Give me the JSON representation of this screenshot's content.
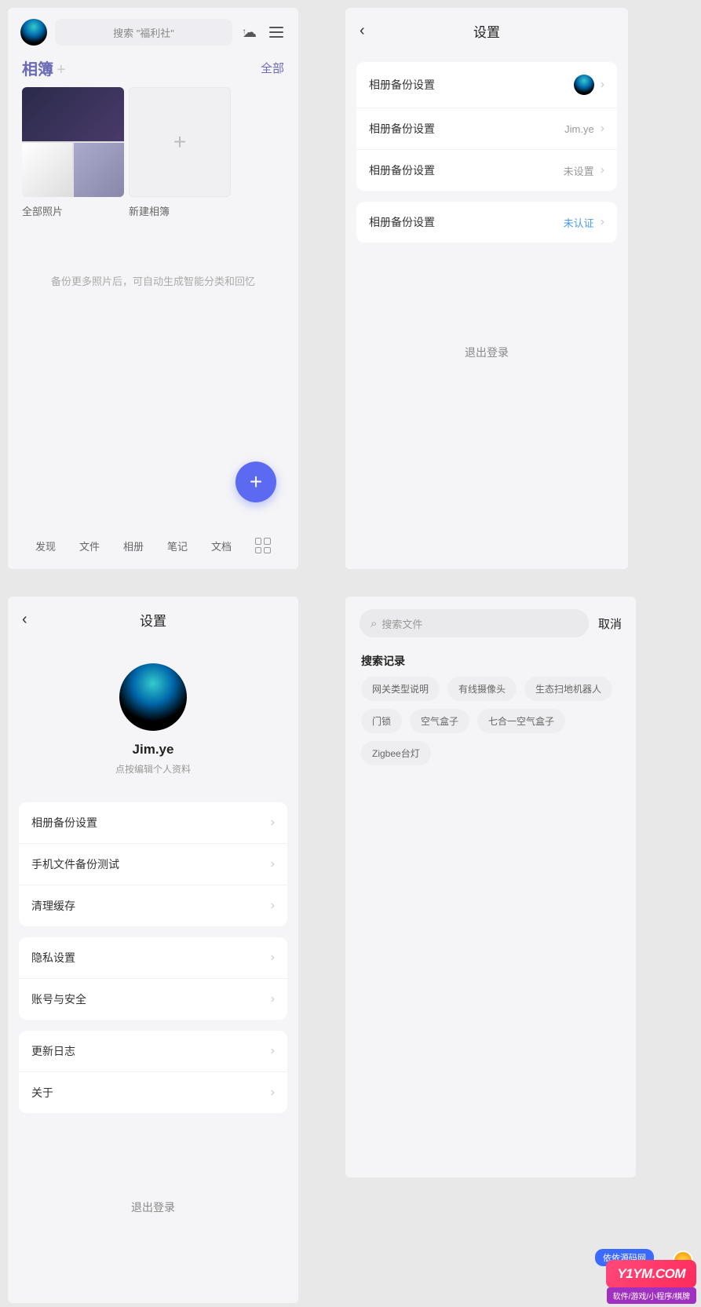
{
  "p1": {
    "search_placeholder": "搜索 \"福利社\"",
    "section_title": "相簿",
    "section_all": "全部",
    "album_all": "全部照片",
    "album_new": "新建相簿",
    "hint": "备份更多照片后，可自动生成智能分类和回忆",
    "tabs": [
      "发现",
      "文件",
      "相册",
      "笔记",
      "文档"
    ]
  },
  "p2": {
    "title": "设置",
    "rows": [
      {
        "label": "相册备份设置",
        "value": ""
      },
      {
        "label": "相册备份设置",
        "value": "Jim.ye"
      },
      {
        "label": "相册备份设置",
        "value": "未设置"
      }
    ],
    "row4": {
      "label": "相册备份设置",
      "value": "未认证"
    },
    "logout": "退出登录"
  },
  "p3": {
    "title": "设置",
    "profile_name": "Jim.ye",
    "profile_sub": "点按编辑个人资料",
    "group1": [
      "相册备份设置",
      "手机文件备份测试",
      "清理缓存"
    ],
    "group2": [
      "隐私设置",
      "账号与安全"
    ],
    "group3": [
      "更新日志",
      "关于"
    ],
    "logout": "退出登录"
  },
  "p4": {
    "search_placeholder": "搜索文件",
    "cancel": "取消",
    "history_title": "搜索记录",
    "chips": [
      "网关类型说明",
      "有线摄像头",
      "生态扫地机器人",
      "门锁",
      "空气盒子",
      "七合一空气盒子",
      "Zigbee台灯"
    ]
  },
  "watermark": {
    "top": "依依源码网",
    "main": "Y1YM.COM",
    "sub": "软件/游戏/小程序/棋牌"
  }
}
